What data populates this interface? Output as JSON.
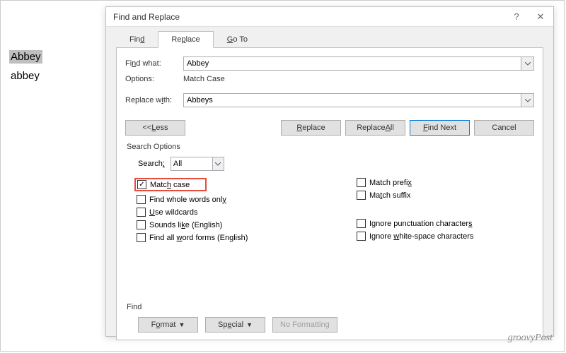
{
  "document": {
    "word1": "Abbey",
    "word2": "abbey"
  },
  "dialog": {
    "title": "Find and Replace",
    "help": "?",
    "close": "✕",
    "tabs": {
      "find": "Find",
      "replace": "Replace",
      "goto": "Go To"
    },
    "find_what_label_pre": "Fi",
    "find_what_label_u": "n",
    "find_what_label_post": "d what:",
    "find_what": "Abbey",
    "options_label": "Options:",
    "options_value": "Match Case",
    "replace_with_label_pre": "Replace w",
    "replace_with_label_u": "i",
    "replace_with_label_post": "th:",
    "replace_with": "Abbeys",
    "buttons": {
      "less_pre": "<< ",
      "less_u": "L",
      "less_post": "ess",
      "replace_u": "R",
      "replace_post": "eplace",
      "replace_all_pre": "Replace ",
      "replace_all_u": "A",
      "replace_all_post": "ll",
      "find_next_u": "F",
      "find_next_post": "ind Next",
      "cancel": "Cancel"
    },
    "search_options_label": "Search Options",
    "search_label": "Search",
    "search_u": ";",
    "search_value": "All",
    "checks": {
      "match_case_pre": "Matc",
      "match_case_u": "h",
      "match_case_post": " case",
      "whole_words_pre": "Find whole words onl",
      "whole_words_u": "y",
      "wildcards_u": "U",
      "wildcards_post": "se wildcards",
      "sounds_pre": "Sounds li",
      "sounds_u": "k",
      "sounds_post": "e (English)",
      "all_forms_pre": "Find all ",
      "all_forms_u": "w",
      "all_forms_post": "ord forms (English)",
      "prefix_pre": "Match prefi",
      "prefix_u": "x",
      "suffix_pre": "Ma",
      "suffix_u": "t",
      "suffix_post": "ch suffix",
      "punct_pre": "Ignore punctuation character",
      "punct_u": "s",
      "ws_pre": "Ignore ",
      "ws_u": "w",
      "ws_post": "hite-space characters"
    },
    "find_label": "Find",
    "format_pre": "F",
    "format_u": "o",
    "format_post": "rmat",
    "special_pre": "Sp",
    "special_u": "e",
    "special_post": "cial",
    "no_formatting": "No Formatting"
  },
  "watermark": "groovyPost"
}
